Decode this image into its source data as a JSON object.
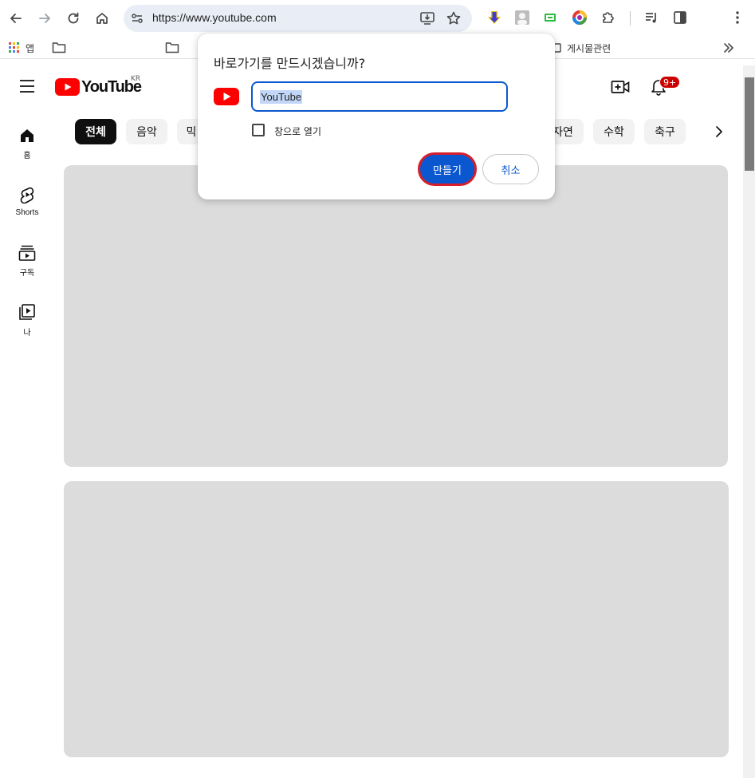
{
  "browser": {
    "url": "https://www.youtube.com",
    "bookmarks": {
      "apps_label": "앱",
      "folder_label": "게시물관련"
    }
  },
  "youtube": {
    "logo_text": "YouTube",
    "region": "KR",
    "notification_count": "9+",
    "guide": [
      {
        "label": "홈",
        "icon": "home-icon"
      },
      {
        "label": "Shorts",
        "icon": "shorts-icon"
      },
      {
        "label": "구독",
        "icon": "subscriptions-icon"
      },
      {
        "label": "나",
        "icon": "you-icon"
      }
    ],
    "chips": [
      {
        "label": "전체",
        "active": true
      },
      {
        "label": "음악",
        "active": false
      },
      {
        "label": "믹",
        "active": false
      },
      {
        "label": "자연",
        "active": false
      },
      {
        "label": "수학",
        "active": false
      },
      {
        "label": "축구",
        "active": false
      }
    ]
  },
  "dialog": {
    "title": "바로가기를 만드시겠습니까?",
    "name_value": "YouTube",
    "open_as_window_label": "창으로 열기",
    "open_as_window_checked": false,
    "create_label": "만들기",
    "cancel_label": "취소"
  },
  "colors": {
    "youtube_red": "#ff0000",
    "primary_blue": "#0b57d0",
    "highlight_red": "#d61f2a",
    "placeholder_gray": "#dcdcdc"
  }
}
